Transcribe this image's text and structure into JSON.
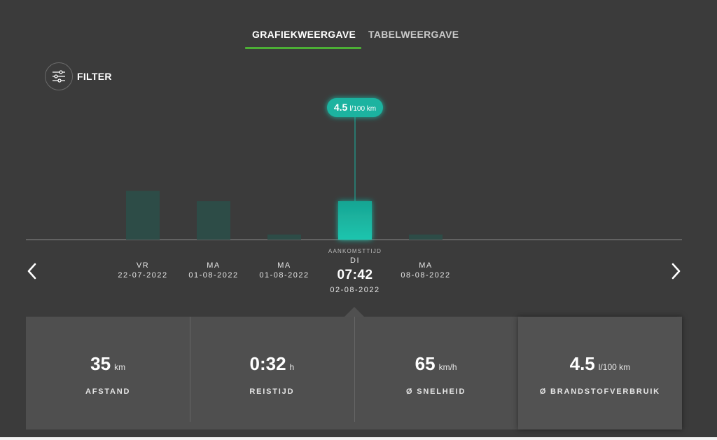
{
  "tabs": [
    {
      "label": "GRAFIEKWEERGAVE",
      "active": true
    },
    {
      "label": "TABELWEERGAVE",
      "active": false
    }
  ],
  "filter": {
    "label": "FILTER",
    "icon": "sliders-icon"
  },
  "colors": {
    "background": "#3b3b3b",
    "accent": "#4caf35",
    "bar_selected": "#1ab3a0",
    "bar_default": "#2d4c47",
    "panel": "#4f4f4f"
  },
  "chart_data": {
    "type": "bar",
    "metric_unit": "l/100 km",
    "categories": [
      {
        "day": "VR",
        "date": "22-07-2022"
      },
      {
        "day": "MA",
        "date": "01-08-2022"
      },
      {
        "day": "MA",
        "date": "01-08-2022"
      },
      {
        "day": "DI",
        "date": "02-08-2022",
        "time": "07:42",
        "caption": "AANKOMSTTIJD"
      },
      {
        "day": "MA",
        "date": "08-08-2022"
      }
    ],
    "values": [
      5.7,
      4.5,
      0.6,
      4.5,
      0.6
    ],
    "selected_index": 3,
    "tooltip": {
      "value": "4.5",
      "unit": "l/100 km"
    }
  },
  "navigation": {
    "prev_icon": "chevron-left-icon",
    "next_icon": "chevron-right-icon"
  },
  "stats": [
    {
      "value": "35",
      "unit": "km",
      "label": "AFSTAND"
    },
    {
      "value": "0:32",
      "unit": "h",
      "label": "REISTIJD"
    },
    {
      "value": "65",
      "unit": "km/h",
      "label": "Ø SNELHEID"
    },
    {
      "value": "4.5",
      "unit": "l/100 km",
      "label": "Ø BRANDSTOFVERBRUIK",
      "active": true
    }
  ]
}
